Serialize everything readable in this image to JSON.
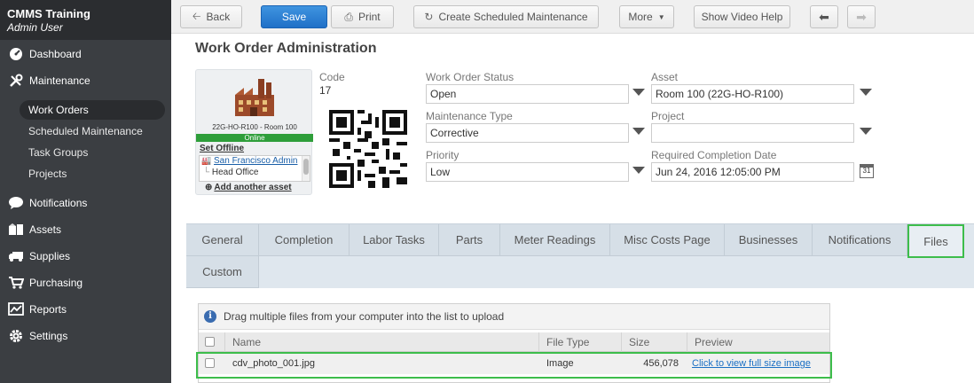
{
  "app": {
    "title": "CMMS Training",
    "user": "Admin User"
  },
  "sidebar": {
    "items": [
      {
        "label": "Dashboard",
        "icon": "dashboard-icon"
      },
      {
        "label": "Maintenance",
        "icon": "tools-icon"
      },
      {
        "label": "Notifications",
        "icon": "chat-bubble-icon"
      },
      {
        "label": "Assets",
        "icon": "boxes-icon"
      },
      {
        "label": "Supplies",
        "icon": "truck-icon"
      },
      {
        "label": "Purchasing",
        "icon": "cart-icon"
      },
      {
        "label": "Reports",
        "icon": "chart-icon"
      },
      {
        "label": "Settings",
        "icon": "gear-icon"
      }
    ],
    "maintenance_sub": [
      "Work Orders",
      "Scheduled Maintenance",
      "Task Groups",
      "Projects"
    ],
    "active_sub": "Work Orders"
  },
  "toolbar": {
    "back": "Back",
    "save": "Save",
    "print": "Print",
    "create_sched": "Create Scheduled Maintenance",
    "more": "More",
    "video": "Show Video Help"
  },
  "page": {
    "title": "Work Order Administration"
  },
  "asset_card": {
    "caption": "22G-HO-R100 - Room 100",
    "status": "Online",
    "set_offline": "Set Offline",
    "assets": [
      "San Francisco Admin",
      "Head Office"
    ],
    "add_asset": "Add another asset"
  },
  "form": {
    "code_label": "Code",
    "code_value": "17",
    "status_label": "Work Order Status",
    "status_value": "Open",
    "asset_label": "Asset",
    "asset_value": "Room 100 (22G-HO-R100)",
    "mtype_label": "Maintenance Type",
    "mtype_value": "Corrective",
    "project_label": "Project",
    "project_value": "",
    "priority_label": "Priority",
    "priority_value": "Low",
    "rcd_label": "Required Completion Date",
    "rcd_value": "Jun 24, 2016 12:05:00 PM",
    "cal_day": "31"
  },
  "tabs": [
    "General",
    "Completion",
    "Labor Tasks",
    "Parts",
    "Meter Readings",
    "Misc Costs Page",
    "Businesses",
    "Notifications",
    "Files",
    "Custom"
  ],
  "active_tab": "Files",
  "files": {
    "hint": "Drag multiple files from your computer into the list to upload",
    "columns": [
      "Name",
      "File Type",
      "Size",
      "Preview"
    ],
    "rows": [
      {
        "name": "cdv_photo_001.jpg",
        "type": "Image",
        "size": "456,078",
        "preview": "Click to view full size image"
      }
    ]
  },
  "colors": {
    "sidebar": "#3b3e42",
    "primary": "#2a7fd4",
    "highlight": "#3dbd4b",
    "online": "#2e9e3a"
  }
}
